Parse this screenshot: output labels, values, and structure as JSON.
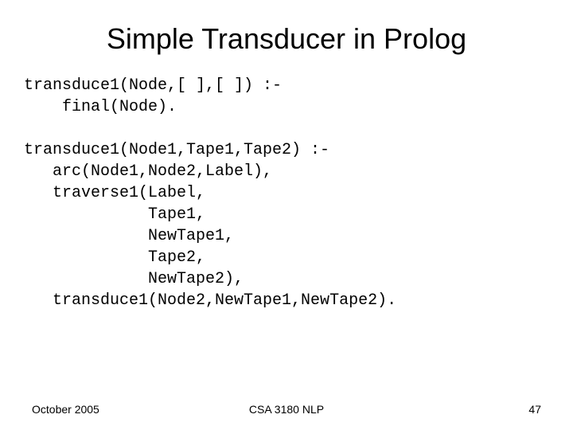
{
  "title": "Simple Transducer in Prolog",
  "code": "transduce1(Node,[ ],[ ]) :-\n    final(Node).\n\ntransduce1(Node1,Tape1,Tape2) :-\n   arc(Node1,Node2,Label),\n   traverse1(Label,\n             Tape1,\n             NewTape1,\n             Tape2,\n             NewTape2),\n   transduce1(Node2,NewTape1,NewTape2).",
  "footer": {
    "left": "October 2005",
    "center": "CSA 3180 NLP",
    "right": "47"
  }
}
